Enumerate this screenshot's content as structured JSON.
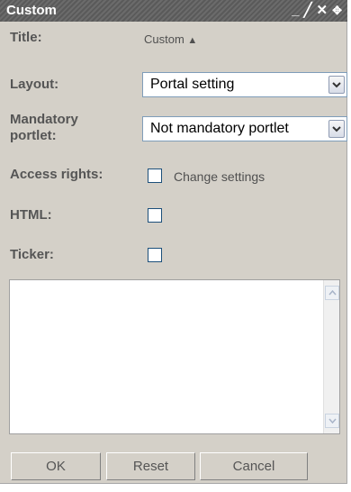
{
  "window": {
    "title": "Custom",
    "icons": [
      "minimize-icon",
      "edit-icon",
      "close-icon",
      "move-icon"
    ]
  },
  "form": {
    "title_label": "Title:",
    "title_value": "Custom",
    "layout_label": "Layout:",
    "layout_value": "Portal setting",
    "mandatory_label_line1": "Mandatory",
    "mandatory_label_line2": "portlet:",
    "mandatory_value": "Not mandatory portlet",
    "access_label": "Access rights:",
    "access_checkbox_label": "Change settings",
    "html_label": "HTML:",
    "ticker_label": "Ticker:",
    "content_value": ""
  },
  "buttons": {
    "ok": "OK",
    "reset": "Reset",
    "cancel": "Cancel"
  }
}
